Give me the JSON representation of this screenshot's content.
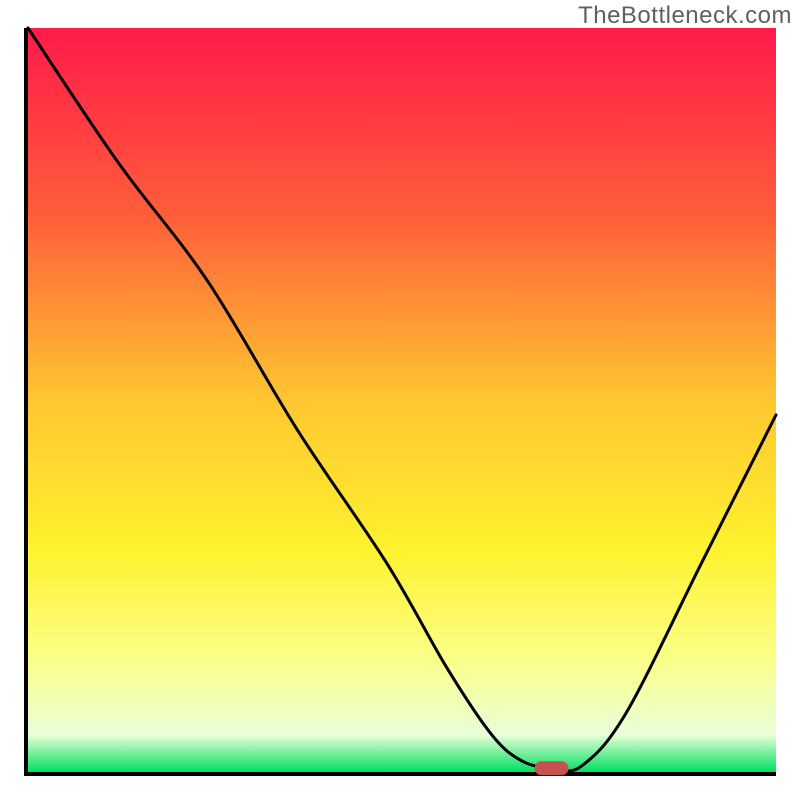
{
  "watermark": "TheBottleneck.com",
  "chart_data": {
    "type": "line",
    "title": "",
    "xlabel": "",
    "ylabel": "",
    "xlim": [
      0,
      100
    ],
    "ylim": [
      0,
      100
    ],
    "background_gradient": {
      "stops": [
        {
          "offset": 0,
          "color": "#ff1a4a"
        },
        {
          "offset": 25,
          "color": "#ff5d3a"
        },
        {
          "offset": 50,
          "color": "#ffc631"
        },
        {
          "offset": 70,
          "color": "#fff22e"
        },
        {
          "offset": 85,
          "color": "#fbff8a"
        },
        {
          "offset": 95,
          "color": "#e8ffd8"
        },
        {
          "offset": 100,
          "color": "#00e060"
        }
      ]
    },
    "series": [
      {
        "name": "bottleneck-curve",
        "color": "#000000",
        "x": [
          0,
          12,
          24,
          36,
          48,
          56,
          62,
          66,
          70,
          74,
          80,
          90,
          100
        ],
        "values": [
          100,
          82,
          66,
          46,
          28,
          14,
          5,
          1.5,
          0.5,
          0.8,
          8,
          28,
          48
        ]
      }
    ],
    "markers": [
      {
        "name": "optimal-point",
        "x": 70,
        "y": 0.5,
        "color": "#c95050",
        "shape": "pill"
      }
    ]
  }
}
